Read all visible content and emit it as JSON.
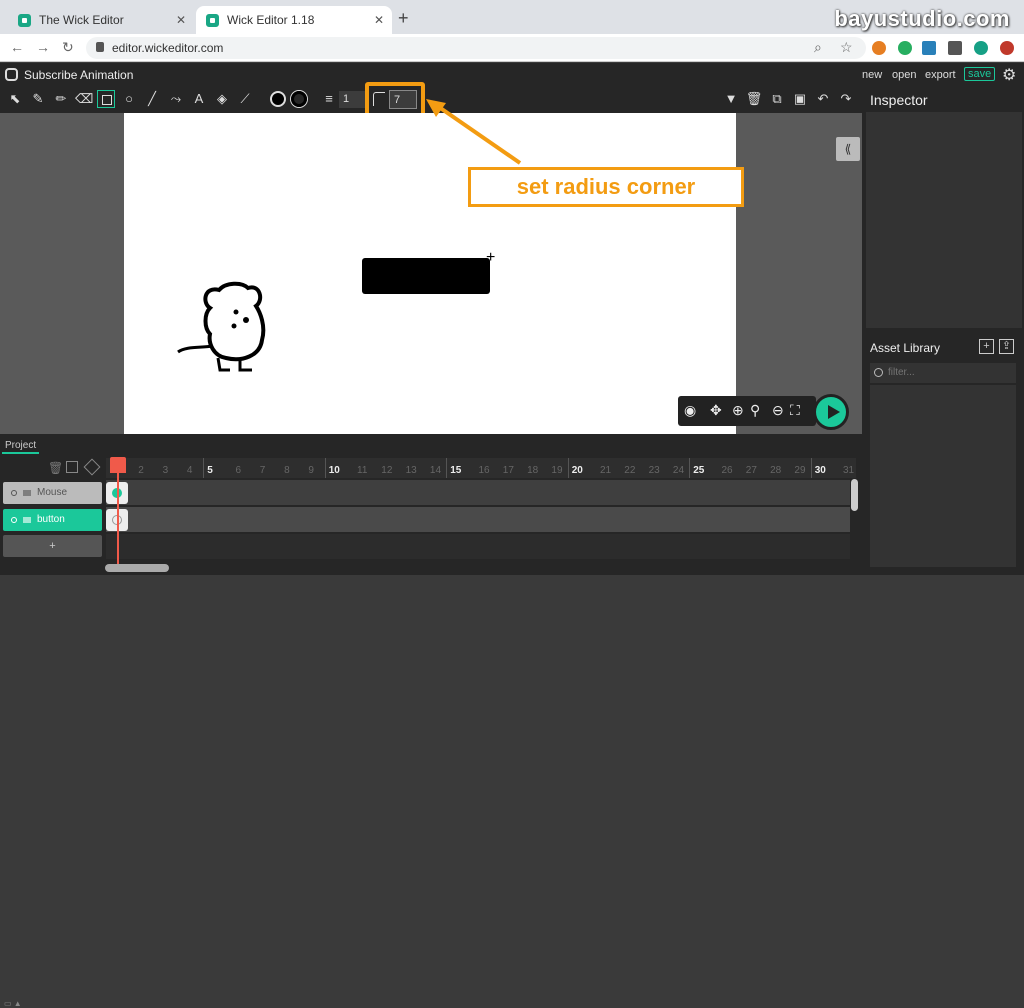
{
  "browser": {
    "tabs": [
      {
        "title": "The Wick Editor"
      },
      {
        "title": "Wick Editor 1.18"
      }
    ],
    "new_tab": "+",
    "url": "editor.wickeditor.com",
    "watermark": "bayustudio.com"
  },
  "editor": {
    "project_name": "Subscribe Animation",
    "menu": {
      "new": "new",
      "open": "open",
      "export": "export",
      "save": "save"
    }
  },
  "toolbar": {
    "tools": [
      "cursor-icon",
      "brush-icon",
      "pencil-icon",
      "eraser-icon",
      "rectangle-icon",
      "ellipse-icon",
      "line-icon",
      "text-icon",
      "fill-bucket-icon",
      "eyedropper-icon"
    ],
    "fill_color": "#000000",
    "stroke_color": "#000000",
    "brush_size": "1",
    "corner_radius": "7"
  },
  "annotation": {
    "callout_text": "set radius corner",
    "accent_color": "#f39c12"
  },
  "inspector": {
    "title": "Inspector"
  },
  "asset_library": {
    "title": "Asset Library",
    "filter_placeholder": "filter..."
  },
  "timeline": {
    "tab": "Project",
    "layers": [
      {
        "name": "Mouse"
      },
      {
        "name": "button"
      }
    ],
    "add_layer": "+",
    "frame_numbers": [
      "1",
      "2",
      "3",
      "4",
      "5",
      "6",
      "7",
      "8",
      "9",
      "10",
      "11",
      "12",
      "13",
      "14",
      "15",
      "16",
      "17",
      "18",
      "19",
      "20",
      "21",
      "22",
      "23",
      "24",
      "25",
      "26",
      "27",
      "28",
      "29",
      "30",
      "31"
    ],
    "current_frame": 1
  },
  "colors": {
    "accent": "#1bc89a",
    "playhead": "#f05a4a"
  }
}
